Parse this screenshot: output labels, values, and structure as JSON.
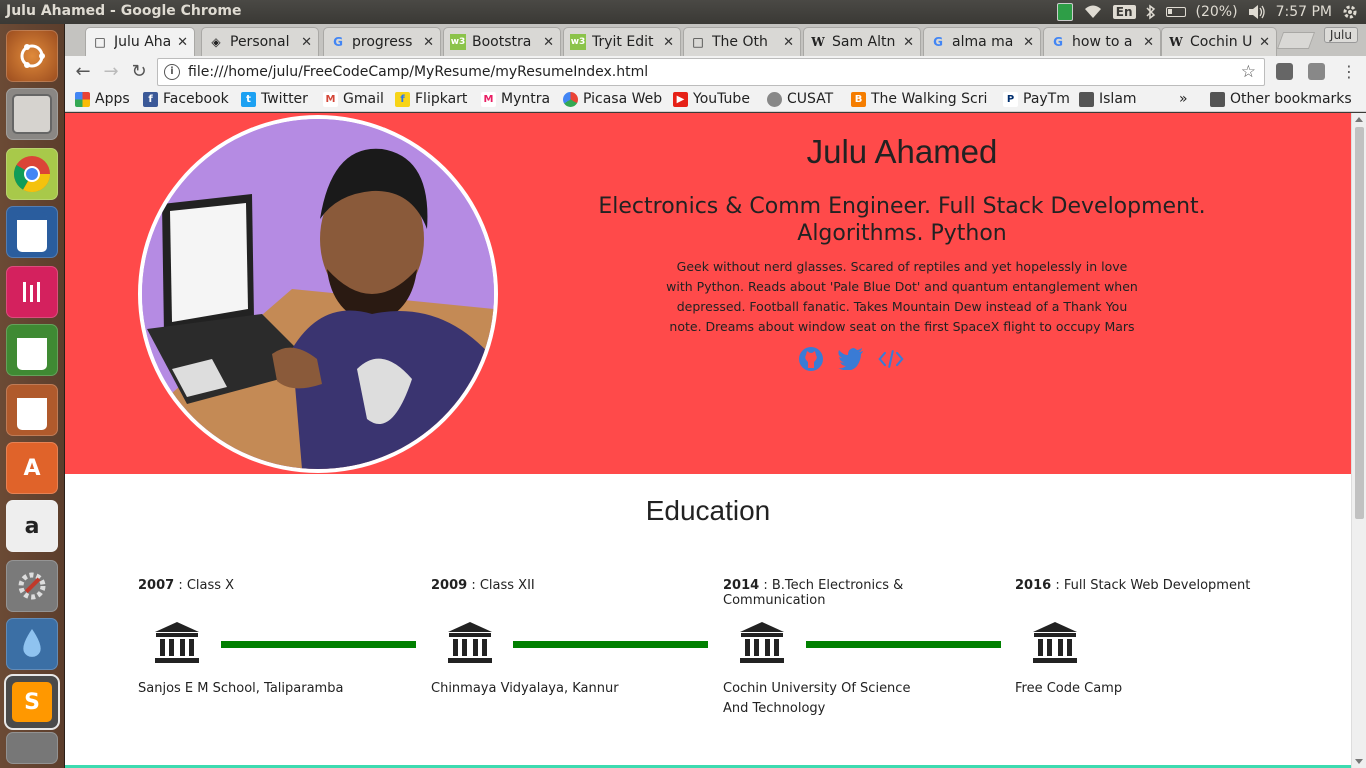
{
  "os": {
    "window_title": "Julu Ahamed - Google Chrome",
    "tray": {
      "language": "En",
      "battery": "(20%)",
      "time": "7:57 PM"
    }
  },
  "browser": {
    "tabs": [
      {
        "label": "Julu Aha",
        "icon": "page-icon",
        "active": true
      },
      {
        "label": "Personal",
        "icon": "codepen-icon"
      },
      {
        "label": "progress",
        "icon": "google-icon"
      },
      {
        "label": "Bootstra",
        "icon": "w3schools-icon"
      },
      {
        "label": "Tryit Edit",
        "icon": "w3schools-icon"
      },
      {
        "label": "The Oth",
        "icon": "page-icon"
      },
      {
        "label": "Sam Altn",
        "icon": "wikipedia-icon"
      },
      {
        "label": "alma ma",
        "icon": "google-icon"
      },
      {
        "label": "how to a",
        "icon": "google-icon"
      },
      {
        "label": "Cochin U",
        "icon": "wikipedia-icon"
      }
    ],
    "profile": "Julu",
    "url": "file:///home/julu/FreeCodeCamp/MyResume/myResumeIndex.html",
    "bookmarks": [
      "Apps",
      "Facebook",
      "Twitter",
      "Gmail",
      "Flipkart",
      "Myntra",
      "Picasa Web",
      "YouTube",
      "CUSAT",
      "The Walking Scri",
      "PayTm",
      "Islam"
    ],
    "more_bookmarks": "»",
    "other_bookmarks": "Other bookmarks"
  },
  "page": {
    "name": "Julu Ahamed",
    "tagline": "Electronics & Comm Engineer. Full Stack Development. Algorithms. Python",
    "bio": "Geek without nerd glasses. Scared of reptiles and yet hopelessly in love with Python. Reads about 'Pale Blue Dot' and quantum entanglement when depressed. Football fanatic. Takes Mountain Dew instead of a Thank You note. Dreams about window seat on the first SpaceX flight to occupy Mars",
    "education_title": "Education",
    "education": [
      {
        "year": "2007",
        "course": " : Class X",
        "school": "Sanjos E M School, Taliparamba"
      },
      {
        "year": "2009",
        "course": " : Class XII",
        "school": "Chinmaya Vidyalaya, Kannur"
      },
      {
        "year": "2014",
        "course": " : B.Tech Electronics & Communication",
        "school": "Cochin University Of Science And Technology"
      },
      {
        "year": "2016",
        "course": " : Full Stack Web Development",
        "school": "Free Code Camp"
      }
    ],
    "colors": {
      "hero_bg": "#ff4a4a",
      "timeline": "#008000",
      "social_icons": "#3a7bd5"
    }
  }
}
